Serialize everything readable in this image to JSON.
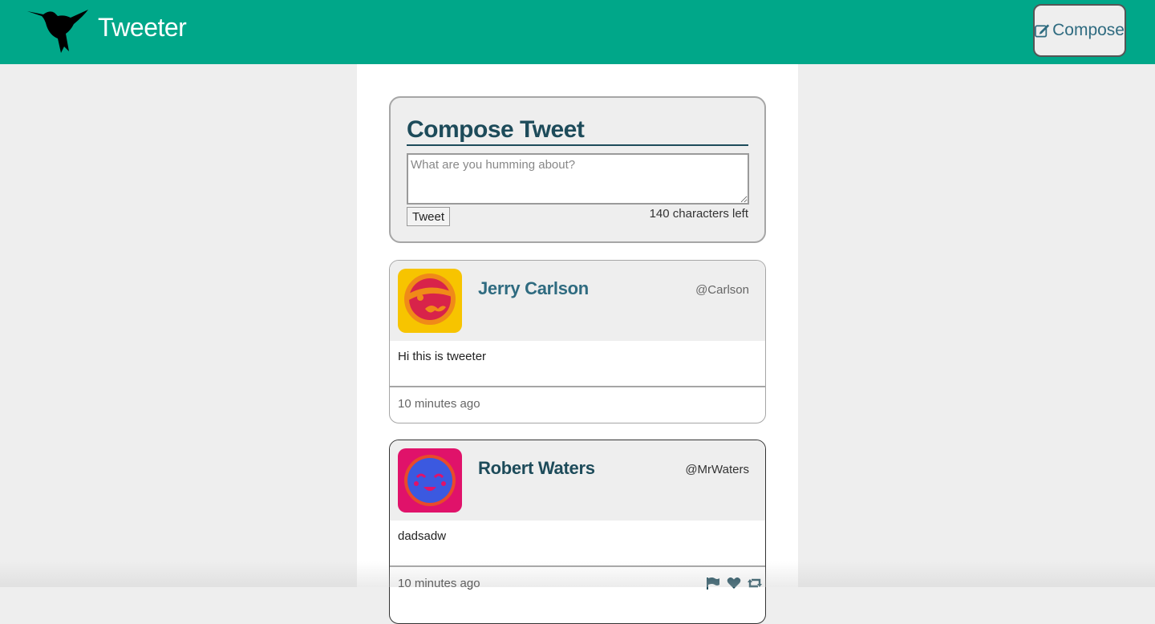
{
  "navbar": {
    "brand": "Tweeter",
    "compose_label": "Compose",
    "color": "#00a789"
  },
  "composer": {
    "title": "Compose Tweet",
    "placeholder": "What are you humming about?",
    "value": "",
    "submit_label": "Tweet",
    "counter": "140 characters left"
  },
  "tweets": [
    {
      "name": "Jerry Carlson",
      "handle": "@Carlson",
      "text": "Hi this is tweeter",
      "time": "10 minutes ago",
      "avatar_icon": "pirate-avatar-icon"
    },
    {
      "name": "Robert Waters",
      "handle": "@MrWaters",
      "text": "dadsadw",
      "time": "10 minutes ago",
      "avatar_icon": "smiley-avatar-icon",
      "actions": [
        "flag-icon",
        "heart-icon",
        "retweet-icon"
      ]
    }
  ]
}
